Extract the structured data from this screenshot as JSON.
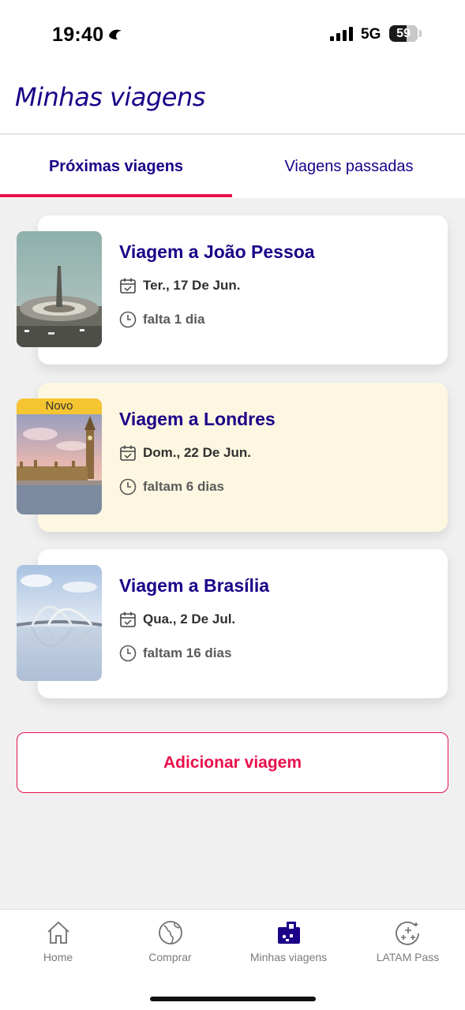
{
  "status_bar": {
    "time": "19:40",
    "network": "5G",
    "battery": "59"
  },
  "header": {
    "title_part1": "Minhas ",
    "title_part2": "viagens"
  },
  "tabs": [
    {
      "label": "Próximas viagens",
      "active": true
    },
    {
      "label": "Viagens passadas",
      "active": false
    }
  ],
  "trips": [
    {
      "title": "Viagem a João Pessoa",
      "date": "Ter., 17 De Jun.",
      "countdown": "falta 1 dia",
      "badge": ""
    },
    {
      "title": "Viagem a Londres",
      "date": "Dom., 22 De Jun.",
      "countdown": "faltam 6 dias",
      "badge": "Novo"
    },
    {
      "title": "Viagem a Brasília",
      "date": "Qua., 2 De Jul.",
      "countdown": "faltam 16 dias",
      "badge": ""
    }
  ],
  "add_button": {
    "label": "Adicionar viagem"
  },
  "bottom_nav": [
    {
      "label": "Home",
      "icon": "home-icon"
    },
    {
      "label": "Comprar",
      "icon": "globe-icon"
    },
    {
      "label": "Minhas viagens",
      "icon": "luggage-icon",
      "active": true
    },
    {
      "label": "LATAM Pass",
      "icon": "latam-pass-icon"
    }
  ],
  "colors": {
    "brand": "#1b0088",
    "accent": "#e8114b",
    "badge": "#f5c431",
    "highlight_card": "#fdf7e1"
  }
}
